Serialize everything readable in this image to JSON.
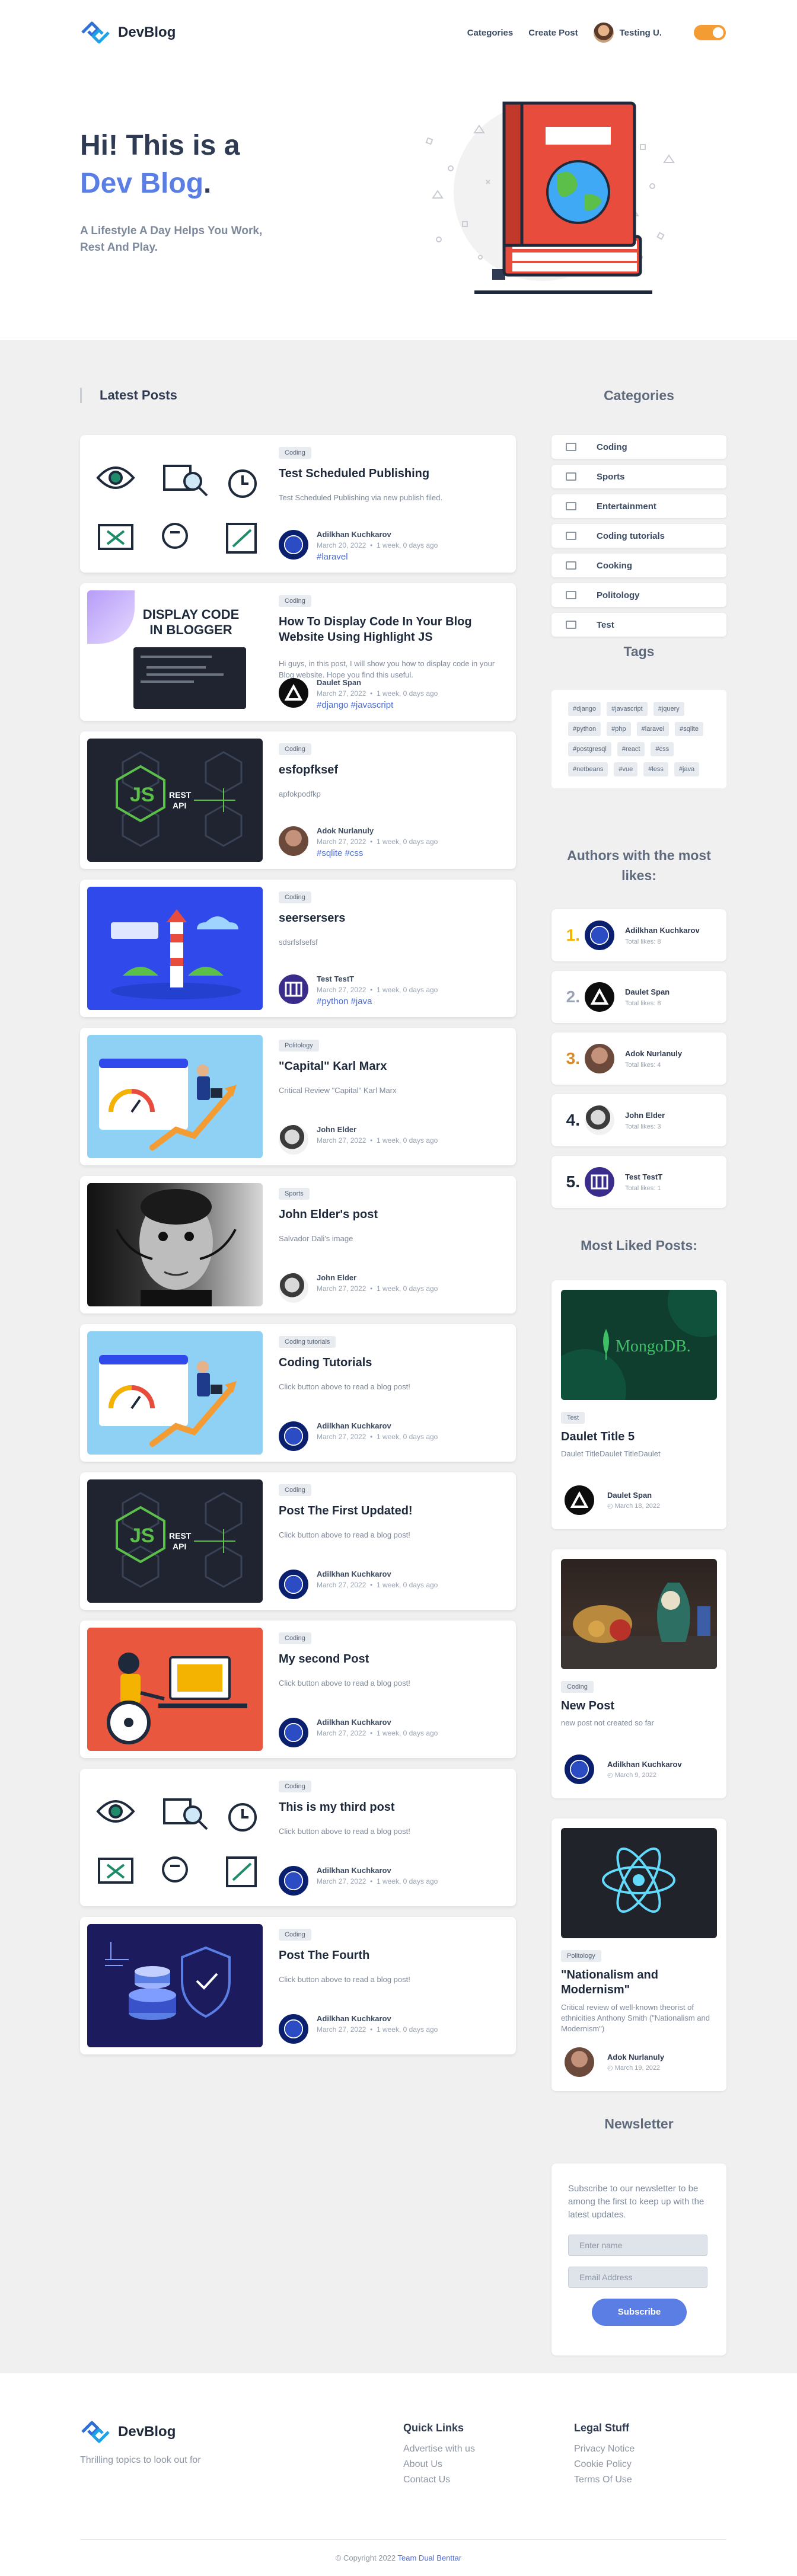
{
  "brand": {
    "name": "DevBlog",
    "tagline": "Thrilling topics to look out for",
    "accent": "#5b7ee5",
    "orange": "#f39c33"
  },
  "nav": {
    "categories": "Categories",
    "create_post": "Create Post",
    "user": "Testing U."
  },
  "hero": {
    "line1": "Hi! This is a",
    "line2": "Dev Blog",
    "dot": ".",
    "subtitle": "A Lifestyle A Day Helps You Work, Rest And Play."
  },
  "latest": {
    "title": "Latest Posts"
  },
  "posts": [
    {
      "category": "Coding",
      "title": "Test Scheduled Publishing",
      "desc": "Test Scheduled Publishing via new publish filed.",
      "author": "Adilkhan Kuchkarov",
      "date": "March 20, 2022",
      "ago": "1 week, 0 days ago",
      "tags": "#laravel"
    },
    {
      "category": "Coding",
      "title": "How To Display Code In Your Blog Website Using Highlight JS",
      "desc": "Hi guys, in this post, I will show you how to display code in your Blog website. Hope you find this useful.",
      "author": "Daulet Span",
      "date": "March 27, 2022",
      "ago": "1 week, 0 days ago",
      "tags": "#django #javascript"
    },
    {
      "category": "Coding",
      "title": "esfopfksef",
      "desc": "apfokpodfkp",
      "author": "Adok Nurlanuly",
      "date": "March 27, 2022",
      "ago": "1 week, 0 days ago",
      "tags": "#sqlite #css"
    },
    {
      "category": "Coding",
      "title": "seersersers",
      "desc": "sdsrfsfsefsf",
      "author": "Test TestT",
      "date": "March 27, 2022",
      "ago": "1 week, 0 days ago",
      "tags": "#python #java"
    },
    {
      "category": "Politology",
      "title": "\"Capital\" Karl Marx",
      "desc": "Critical Review \"Capital\" Karl Marx",
      "author": "John Elder",
      "date": "March 27, 2022",
      "ago": "1 week, 0 days ago",
      "tags": ""
    },
    {
      "category": "Sports",
      "title": "John Elder's post",
      "desc": "Salvador Dali's image",
      "author": "John Elder",
      "date": "March 27, 2022",
      "ago": "1 week, 0 days ago",
      "tags": ""
    },
    {
      "category": "Coding tutorials",
      "title": "Coding Tutorials",
      "desc": "Click button above to read a blog post!",
      "author": "Adilkhan Kuchkarov",
      "date": "March 27, 2022",
      "ago": "1 week, 0 days ago",
      "tags": ""
    },
    {
      "category": "Coding",
      "title": "Post The First Updated!",
      "desc": "Click button above to read a blog post!",
      "author": "Adilkhan Kuchkarov",
      "date": "March 27, 2022",
      "ago": "1 week, 0 days ago",
      "tags": ""
    },
    {
      "category": "Coding",
      "title": "My second Post",
      "desc": "Click button above to read a blog post!",
      "author": "Adilkhan Kuchkarov",
      "date": "March 27, 2022",
      "ago": "1 week, 0 days ago",
      "tags": ""
    },
    {
      "category": "Coding",
      "title": "This is my third post",
      "desc": "Click button above to read a blog post!",
      "author": "Adilkhan Kuchkarov",
      "date": "March 27, 2022",
      "ago": "1 week, 0 days ago",
      "tags": ""
    },
    {
      "category": "Coding",
      "title": "Post The Fourth",
      "desc": "Click button above to read a blog post!",
      "author": "Adilkhan Kuchkarov",
      "date": "March 27, 2022",
      "ago": "1 week, 0 days ago",
      "tags": ""
    }
  ],
  "sidebar": {
    "categories_title": "Categories",
    "categories": [
      "Coding",
      "Sports",
      "Entertainment",
      "Coding tutorials",
      "Cooking",
      "Politology",
      "Test"
    ],
    "tags_title": "Tags",
    "tags": [
      "#django",
      "#javascript",
      "#jquery",
      "#python",
      "#php",
      "#laravel",
      "#sqlite",
      "#postgresql",
      "#react",
      "#css",
      "#netbeans",
      "#vue",
      "#less",
      "#java"
    ],
    "authors_title": "Authors with the most likes:",
    "authors": [
      {
        "rank": "1.",
        "name": "Adilkhan Kuchkarov",
        "likes": "Total likes: 8",
        "color": "#f5b301"
      },
      {
        "rank": "2.",
        "name": "Daulet Span",
        "likes": "Total likes: 8",
        "color": "#9aa4b2"
      },
      {
        "rank": "3.",
        "name": "Adok Nurlanuly",
        "likes": "Total likes: 4",
        "color": "#d98b2b"
      },
      {
        "rank": "4.",
        "name": "John Elder",
        "likes": "Total likes: 3",
        "color": "#1e293b"
      },
      {
        "rank": "5.",
        "name": "Test TestT",
        "likes": "Total likes: 1",
        "color": "#1e293b"
      }
    ],
    "liked_title": "Most Liked Posts:",
    "liked": [
      {
        "category": "Test",
        "title": "Daulet Title 5",
        "desc": "Daulet TitleDaulet TitleDaulet",
        "author": "Daulet Span",
        "date": "March 18, 2022",
        "mongo_text": "MongoDB."
      },
      {
        "category": "Coding",
        "title": "New Post",
        "desc": "new post not created so far",
        "author": "Adilkhan Kuchkarov",
        "date": "March 9, 2022"
      },
      {
        "category": "Politology",
        "title": "\"Nationalism and Modernism\"",
        "desc": "Critical review of well-known theorist of ethnicities Anthony Smith (\"Nationalism and Modernism\")",
        "author": "Adok Nurlanuly",
        "date": "March 19, 2022"
      }
    ],
    "newsletter_title": "Newsletter",
    "newsletter_text": "Subscribe to our newsletter to be among the first to keep up with the latest updates.",
    "name_placeholder": "Enter name",
    "email_placeholder": "Email Address",
    "subscribe": "Subscribe"
  },
  "thumb_text": {
    "display_code": "DISPLAY CODE IN BLOGGER",
    "rest_api": "REST API"
  },
  "footer": {
    "quick_title": "Quick Links",
    "quick": [
      "Advertise with us",
      "About Us",
      "Contact Us"
    ],
    "legal_title": "Legal Stuff",
    "legal": [
      "Privacy Notice",
      "Cookie Policy",
      "Terms Of Use"
    ],
    "copyright": "© Copyright 2022",
    "team": "Team Dual Benttar"
  }
}
